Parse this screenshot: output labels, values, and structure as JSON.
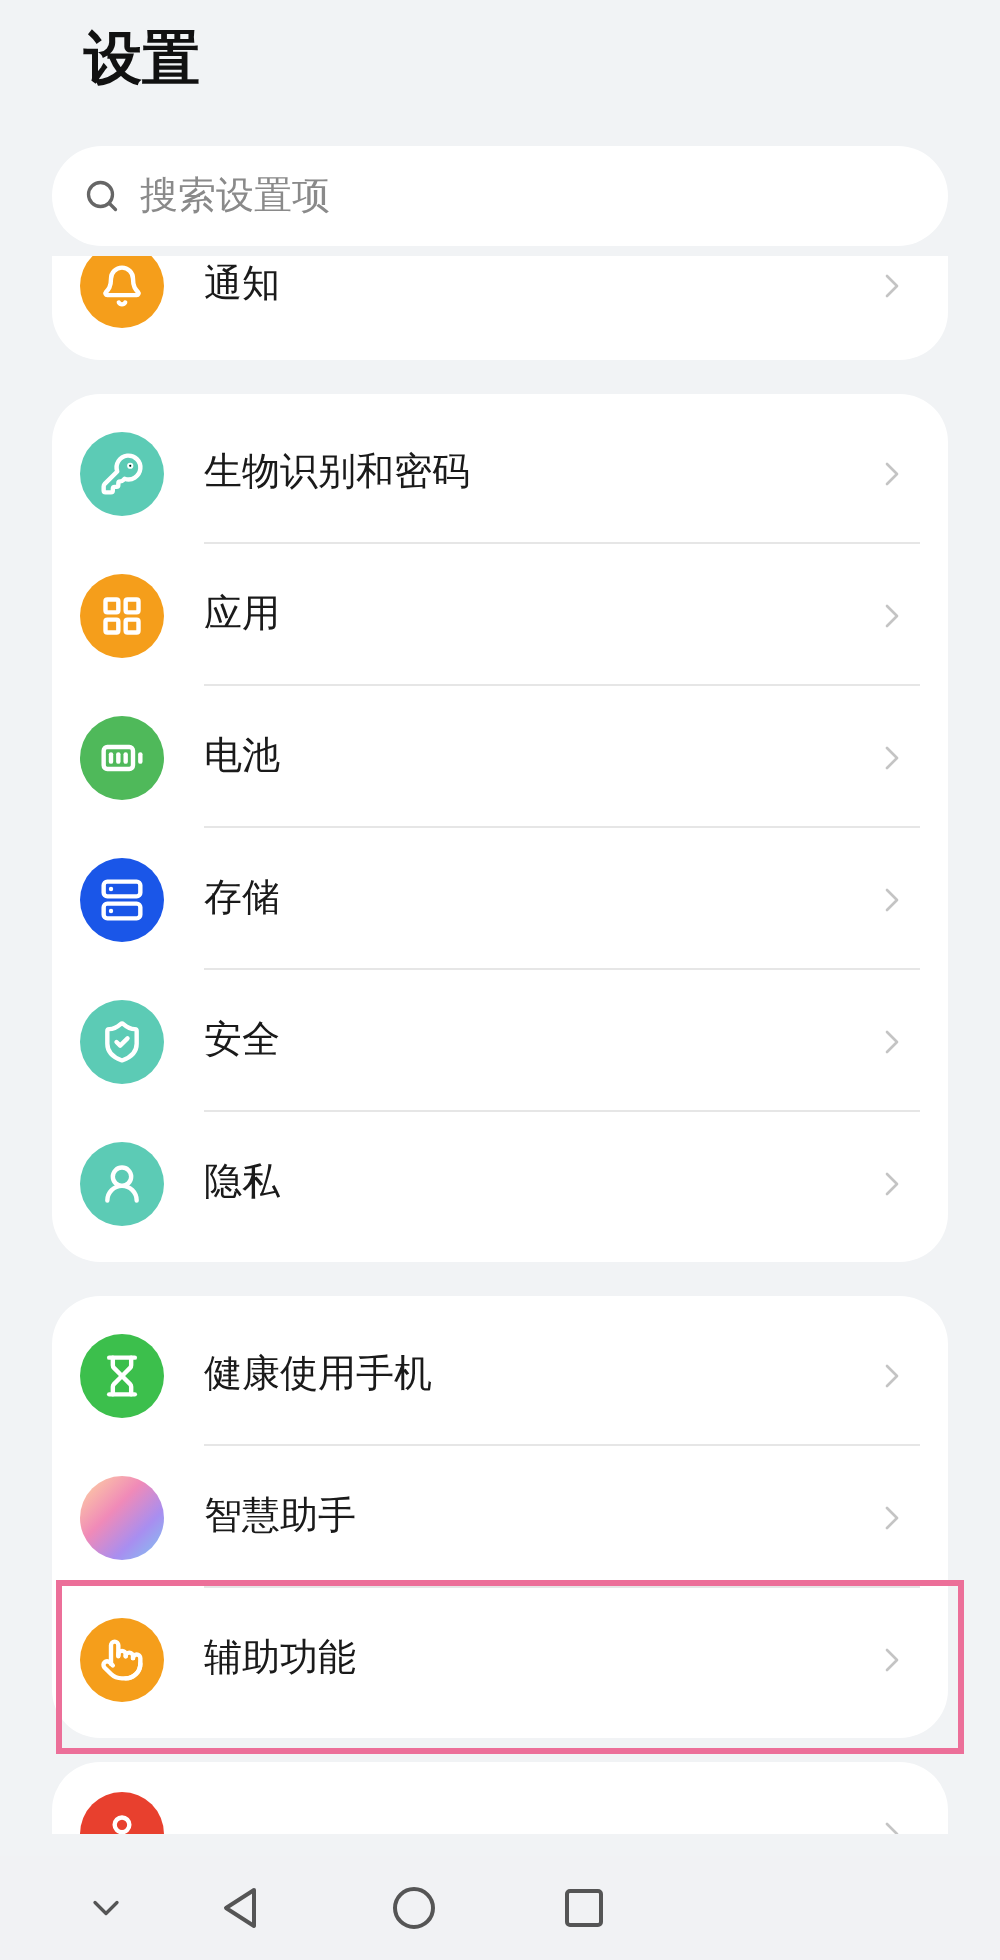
{
  "title": "设置",
  "search": {
    "placeholder": "搜索设置项"
  },
  "groups": [
    {
      "cut_top": true,
      "items": [
        {
          "label": "通知",
          "color": "#f59e1b",
          "highlighted": false
        }
      ]
    },
    {
      "items": [
        {
          "label": "生物识别和密码",
          "color": "#5ccbb5",
          "highlighted": false
        },
        {
          "label": "应用",
          "color": "#f59e1b",
          "highlighted": false
        },
        {
          "label": "电池",
          "color": "#4fb95a",
          "highlighted": false
        },
        {
          "label": "存储",
          "color": "#1a56e8",
          "highlighted": false
        },
        {
          "label": "安全",
          "color": "#5ccbb5",
          "highlighted": false
        },
        {
          "label": "隐私",
          "color": "#5ccbb5",
          "highlighted": false
        }
      ]
    },
    {
      "items": [
        {
          "label": "健康使用手机",
          "color": "#3cbf4c",
          "highlighted": false
        },
        {
          "label": "智慧助手",
          "highlighted": false
        },
        {
          "label": "辅助功能",
          "color": "#f59e1b",
          "highlighted": true
        }
      ]
    },
    {
      "cut_bottom": true,
      "items": [
        {
          "color": "#e8402e",
          "highlighted": false
        }
      ]
    }
  ]
}
